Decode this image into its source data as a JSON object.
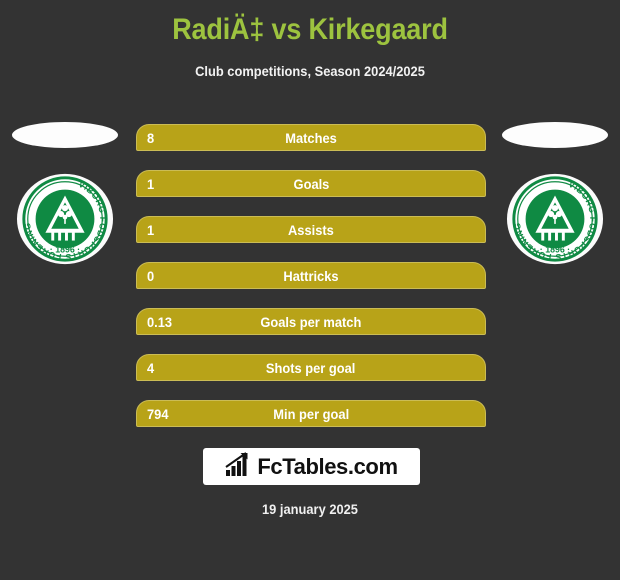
{
  "header": {
    "title": "RadiÄ‡ vs Kirkegaard",
    "subtitle": "Club competitions, Season 2024/2025"
  },
  "sides": {
    "left": {
      "flag_icon": "flag-ellipse-icon",
      "club_badge_icon": "viborg-ff-badge-icon",
      "badge_ring_text": "VIBORG FODSPORTS FORENING",
      "badge_year": "1896"
    },
    "right": {
      "flag_icon": "flag-ellipse-icon",
      "club_badge_icon": "viborg-ff-badge-icon",
      "badge_ring_text": "VIBORG FODSPORTS FORENING",
      "badge_year": "1896"
    }
  },
  "stats": [
    {
      "value": "8",
      "label": "Matches"
    },
    {
      "value": "1",
      "label": "Goals"
    },
    {
      "value": "1",
      "label": "Assists"
    },
    {
      "value": "0",
      "label": "Hattricks"
    },
    {
      "value": "0.13",
      "label": "Goals per match"
    },
    {
      "value": "4",
      "label": "Shots per goal"
    },
    {
      "value": "794",
      "label": "Min per goal"
    }
  ],
  "footer": {
    "logo_text": "FcTables.com",
    "logo_icon": "bar-chart-arrow-icon",
    "date": "19 january 2025"
  },
  "colors": {
    "background": "#333333",
    "title": "#9dc33f",
    "bar_fill": "#b8a318",
    "bar_border": "#cbbc55",
    "bar_text": "#ffffff",
    "badge_green": "#0f8a43",
    "logo_background": "#ffffff"
  },
  "chart_data": {
    "type": "table",
    "title": "RadiÄ‡ vs Kirkegaard",
    "subtitle": "Club competitions, Season 2024/2025",
    "categories": [
      "Matches",
      "Goals",
      "Assists",
      "Hattricks",
      "Goals per match",
      "Shots per goal",
      "Min per goal"
    ],
    "values": [
      8,
      1,
      1,
      0,
      0.13,
      4,
      794
    ],
    "xlabel": "",
    "ylabel": "",
    "legend": []
  }
}
